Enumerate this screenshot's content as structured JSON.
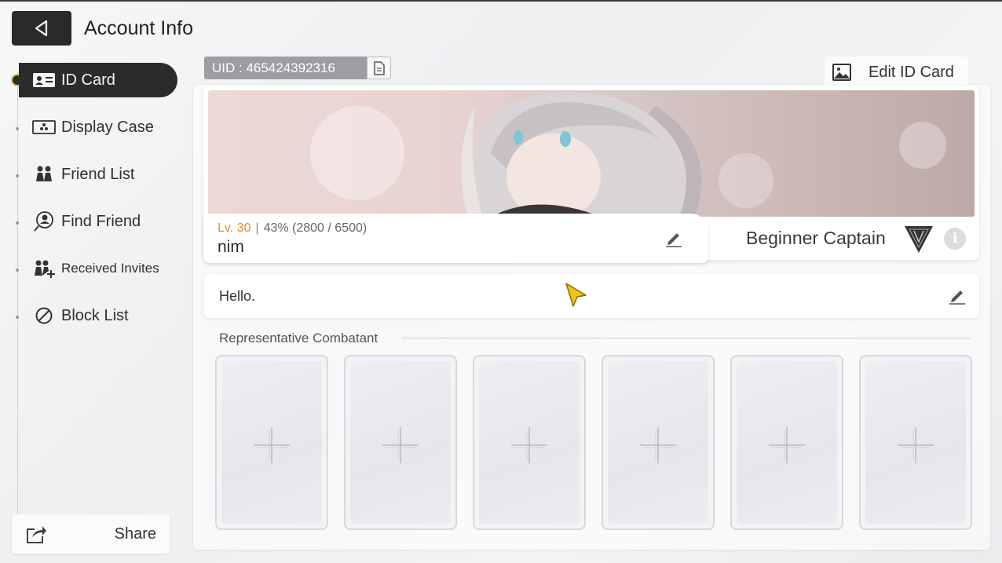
{
  "header": {
    "title": "Account Info"
  },
  "sidebar": {
    "items": [
      {
        "label": "ID Card",
        "icon": "id-card-icon",
        "active": true
      },
      {
        "label": "Display Case",
        "icon": "display-case-icon"
      },
      {
        "label": "Friend List",
        "icon": "friends-icon"
      },
      {
        "label": "Find Friend",
        "icon": "find-friend-icon"
      },
      {
        "label": "Received Invites",
        "icon": "invites-icon"
      },
      {
        "label": "Block List",
        "icon": "block-icon"
      }
    ],
    "share_label": "Share"
  },
  "id_card": {
    "uid": "UID : 465424392316",
    "edit_label": "Edit ID Card",
    "level": "Lv. 30",
    "exp_text": "43% (2800 / 6500)",
    "exp_progress": 0.43,
    "nickname": "nim",
    "rank_title": "Beginner Captain",
    "greeting": "Hello."
  },
  "representative": {
    "label": "Representative Combatant",
    "slots": 6
  },
  "colors": {
    "accent_level": "#e5892e",
    "active_nav": "#2b2b2b"
  }
}
